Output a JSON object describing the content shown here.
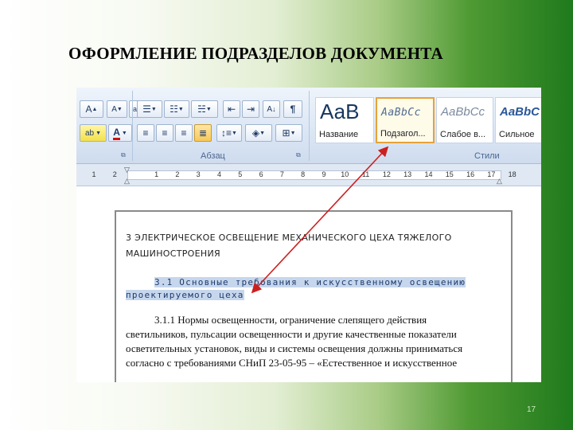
{
  "slide": {
    "title": "ОФОРМЛЕНИЕ ПОДРАЗДЕЛОВ ДОКУМЕНТА",
    "page_number": "17"
  },
  "ribbon": {
    "font_group": {
      "grow_font": "A",
      "shrink_font": "A",
      "clear_format": "ab",
      "highlight": "ab",
      "font_color": "A"
    },
    "paragraph_group": {
      "label": "Абзац",
      "sort": "A",
      "show_marks": "¶"
    },
    "styles_group": {
      "label": "Стили",
      "items": [
        {
          "sample": "АаВ",
          "name": "Название"
        },
        {
          "sample": "АаBbCc",
          "name": "Подзагол..."
        },
        {
          "sample": "AaBbCc",
          "name": "Слабое в..."
        },
        {
          "sample": "AaBbC",
          "name": "Сильное"
        }
      ]
    }
  },
  "ruler": {
    "numbers": [
      "1",
      "2",
      "1",
      "2",
      "3",
      "4",
      "5",
      "6",
      "7",
      "8",
      "9",
      "10",
      "11",
      "12",
      "13",
      "14",
      "15",
      "16",
      "17",
      "18"
    ]
  },
  "document": {
    "heading2_line1": "3 ЭЛЕКТРИЧЕСКОЕ ОСВЕЩЕНИЕ МЕХАНИЧЕСКОГО ЦЕХА ТЯЖЕЛОГО",
    "heading2_line2": "МАШИНОСТРОЕНИЯ",
    "heading3_line1": "3.1 Основные требования к искусственному освещению",
    "heading3_line2": "проектируемого цеха",
    "body_lines": [
      "3.1.1 Нормы освещенности, ограничение слепящего действия",
      "светильников, пульсации освещенности и другие качественные показатели",
      "осветительных установок, виды и системы освещения должны приниматься",
      "согласно с требованиями СНиП 23-05-95 – «Естественное и искусственное"
    ]
  },
  "colors": {
    "selected_style_border": "#e6a23a",
    "heading_highlight": "#c6d6ec",
    "arrow": "#cc1f1f"
  }
}
